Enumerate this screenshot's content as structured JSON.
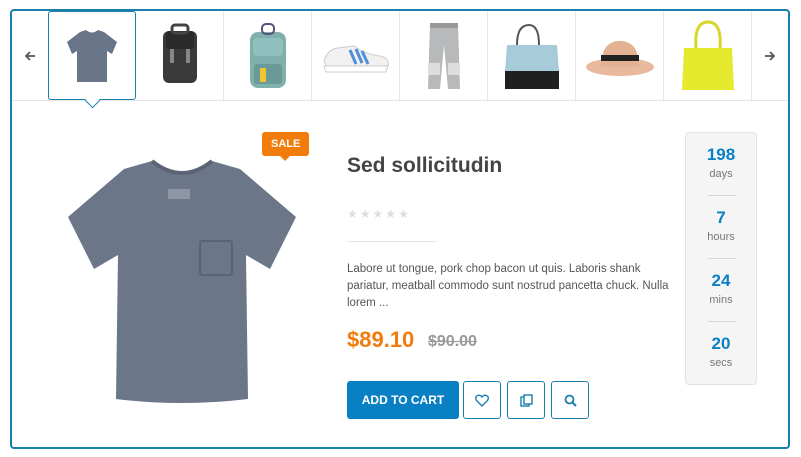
{
  "thumbnails": [
    {
      "name": "tshirt-thumb",
      "alt": "Gray t-shirt"
    },
    {
      "name": "backpack-black-thumb",
      "alt": "Black backpack"
    },
    {
      "name": "backpack-teal-thumb",
      "alt": "Teal backpack"
    },
    {
      "name": "sneaker-thumb",
      "alt": "White sneaker"
    },
    {
      "name": "pants-thumb",
      "alt": "Gray pants"
    },
    {
      "name": "tote-blue-thumb",
      "alt": "Blue tote bag"
    },
    {
      "name": "hat-thumb",
      "alt": "Straw hat"
    },
    {
      "name": "tote-yellow-thumb",
      "alt": "Yellow tote bag"
    }
  ],
  "nav": {
    "prev_icon": "arrow-left-icon",
    "next_icon": "arrow-right-icon"
  },
  "product": {
    "badge": "SALE",
    "title": "Sed sollicitudin",
    "rating": 0,
    "rating_max": 5,
    "description": "Labore ut tongue, pork chop bacon ut quis. Laboris shank pariatur, meatball commodo sunt nostrud pancetta chuck. Nulla lorem ...",
    "price": "$89.10",
    "old_price": "$90.00"
  },
  "actions": {
    "add_to_cart": "ADD TO CART",
    "wishlist_icon": "heart-icon",
    "compare_icon": "copy-icon",
    "quickview_icon": "search-icon"
  },
  "countdown": [
    {
      "value": "198",
      "label": "days"
    },
    {
      "value": "7",
      "label": "hours"
    },
    {
      "value": "24",
      "label": "mins"
    },
    {
      "value": "20",
      "label": "secs"
    }
  ],
  "colors": {
    "accent": "#0a80c4",
    "sale": "#f27c0b",
    "border": "#1b7fae"
  }
}
